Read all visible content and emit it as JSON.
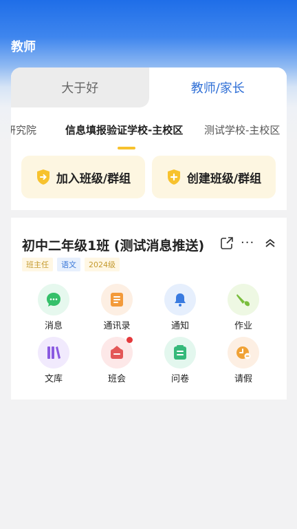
{
  "header": {
    "title": "教师"
  },
  "role_tabs": [
    {
      "label": "大于好",
      "active": false
    },
    {
      "label": "教师/家长",
      "active": true
    }
  ],
  "schools": [
    {
      "label": "研究院",
      "active": false
    },
    {
      "label": "信息填报验证学校-主校区",
      "active": true
    },
    {
      "label": "测试学校-主校区",
      "active": false
    }
  ],
  "actions": {
    "join": "加入班级/群组",
    "create": "创建班级/群组"
  },
  "class_card": {
    "title": "初中二年级1班 (测试消息推送)",
    "more": "···",
    "tags": [
      "班主任",
      "语文",
      "2024级"
    ]
  },
  "features": [
    {
      "label": "消息",
      "icon": "message-icon",
      "bg": "#e6f8ee",
      "color": "#35c06a"
    },
    {
      "label": "通讯录",
      "icon": "contacts-icon",
      "bg": "#fdefe3",
      "color": "#f39a3a"
    },
    {
      "label": "通知",
      "icon": "bell-icon",
      "bg": "#e6effd",
      "color": "#3a7be0"
    },
    {
      "label": "作业",
      "icon": "brush-icon",
      "bg": "#eef8e3",
      "color": "#79bd3c"
    },
    {
      "label": "文库",
      "icon": "library-icon",
      "bg": "#f1eafd",
      "color": "#8a5ae0"
    },
    {
      "label": "班会",
      "icon": "meeting-icon",
      "bg": "#fde8e8",
      "color": "#e35757",
      "badge": true
    },
    {
      "label": "问卷",
      "icon": "questionnaire-icon",
      "bg": "#e3f7ee",
      "color": "#35b97a"
    },
    {
      "label": "请假",
      "icon": "leave-icon",
      "bg": "#fdefe3",
      "color": "#f0a236"
    }
  ],
  "colors": {
    "accent": "#2f6fd6",
    "yellow": "#f7c22e"
  }
}
